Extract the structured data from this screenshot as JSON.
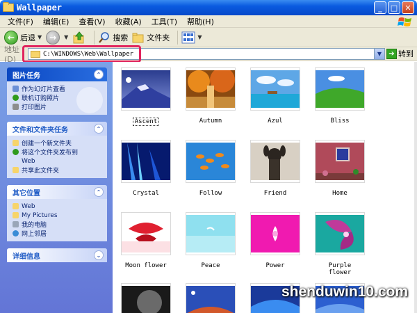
{
  "window": {
    "title": "Wallpaper",
    "controls": [
      "_",
      "□",
      "✕"
    ]
  },
  "menu": [
    "文件(F)",
    "编辑(E)",
    "查看(V)",
    "收藏(A)",
    "工具(T)",
    "帮助(H)"
  ],
  "toolbar": {
    "back_label": "后退",
    "search_label": "搜索",
    "folders_label": "文件夹"
  },
  "address": {
    "label": "地址(D)",
    "value": "C:\\WINDOWS\\Web\\Wallpaper",
    "go_label": "转到"
  },
  "sidebar": {
    "panels": [
      {
        "title": "图片任务",
        "items": [
          "作为幻灯片查看",
          "联机订购照片",
          "打印图片"
        ]
      },
      {
        "title": "文件和文件夹任务",
        "items": [
          "创建一个新文件夹",
          "将这个文件夹发布到",
          "Web",
          "共享此文件夹"
        ]
      },
      {
        "title": "其它位置",
        "items": [
          "Web",
          "My Pictures",
          "我的电脑",
          "网上邻居"
        ]
      },
      {
        "title": "详细信息",
        "items": []
      }
    ]
  },
  "files": [
    {
      "name": "Ascent",
      "selected": true
    },
    {
      "name": "Autumn"
    },
    {
      "name": "Azul"
    },
    {
      "name": "Bliss"
    },
    {
      "name": "Crystal"
    },
    {
      "name": "Follow"
    },
    {
      "name": "Friend"
    },
    {
      "name": "Home"
    },
    {
      "name": "Moon flower"
    },
    {
      "name": "Peace"
    },
    {
      "name": "Power"
    },
    {
      "name": "Purple flower"
    }
  ],
  "watermark": "shenduwin10.com",
  "colors": {
    "title_bar": "#0a5be0",
    "sidebar": "#7ba2e7",
    "highlight": "#e0245e"
  }
}
